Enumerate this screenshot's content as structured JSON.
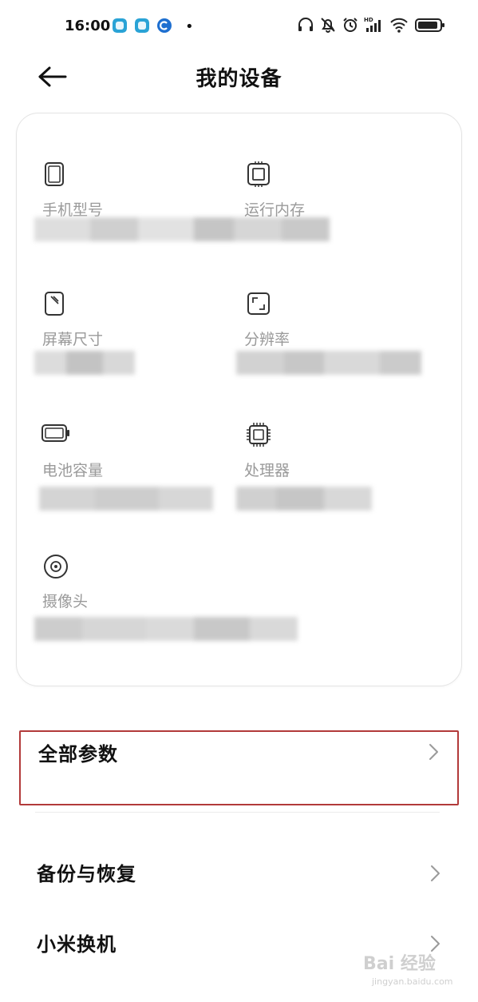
{
  "status_bar": {
    "time": "16:00",
    "notification_icons": [
      "app-notification-icon",
      "app-notification-icon",
      "app-notification-icon"
    ],
    "right_icons": [
      "headphones-icon",
      "bell-muted-icon",
      "alarm-icon",
      "signal-hd-icon",
      "wifi-icon",
      "battery-icon"
    ],
    "hd_label": "HD"
  },
  "header": {
    "title": "我的设备",
    "back_icon": "arrow-left-icon"
  },
  "device_specs": [
    {
      "icon": "phone-outline-icon",
      "label": "手机型号"
    },
    {
      "icon": "memory-chip-icon",
      "label": "运行内存"
    },
    {
      "icon": "screen-size-icon",
      "label": "屏幕尺寸"
    },
    {
      "icon": "resolution-icon",
      "label": "分辨率"
    },
    {
      "icon": "battery-outline-icon",
      "label": "电池容量"
    },
    {
      "icon": "processor-icon",
      "label": "处理器"
    },
    {
      "icon": "camera-lens-icon",
      "label": "摄像头"
    }
  ],
  "menu": [
    {
      "label": "全部参数",
      "highlighted": true
    },
    {
      "label": "备份与恢复",
      "highlighted": false
    },
    {
      "label": "小米换机",
      "highlighted": false
    }
  ],
  "colors": {
    "highlight_border": "#b23a3a",
    "label_gray": "#9a9a9a",
    "app_icon_blue": "#2aa3d6"
  },
  "watermark": {
    "text": "Bai 经验",
    "sub": "jingyan.baidu.com"
  }
}
